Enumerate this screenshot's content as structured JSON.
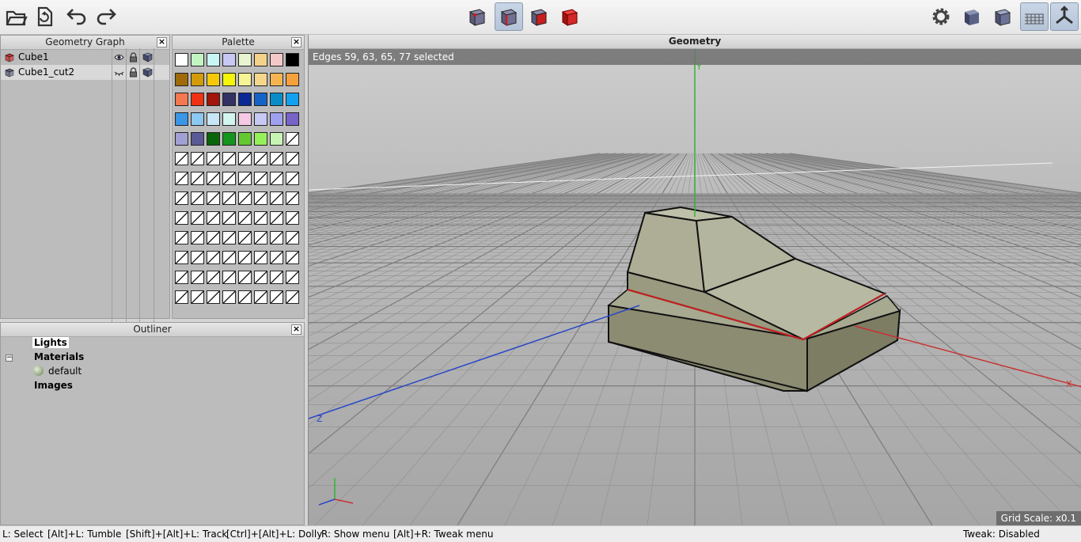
{
  "toolbar": {
    "left_buttons": [
      {
        "name": "open-file-icon"
      },
      {
        "name": "export-file-icon"
      },
      {
        "name": "undo-icon"
      },
      {
        "name": "redo-icon"
      }
    ],
    "mode_buttons": [
      {
        "name": "vertex-mode-icon",
        "active": false
      },
      {
        "name": "edge-mode-icon",
        "active": true
      },
      {
        "name": "face-mode-icon",
        "active": false
      },
      {
        "name": "object-mode-icon",
        "active": false
      }
    ],
    "right_buttons": [
      {
        "name": "settings-gear-icon"
      },
      {
        "name": "smooth-shading-icon"
      },
      {
        "name": "flat-shading-icon"
      },
      {
        "name": "ground-plane-icon",
        "active": true
      },
      {
        "name": "axes-toggle-icon",
        "active": true
      }
    ]
  },
  "geometry_graph": {
    "title": "Geometry Graph",
    "items": [
      {
        "label": "Cube1",
        "color": "#d42a2a",
        "visible": true,
        "selected": false
      },
      {
        "label": "Cube1_cut2",
        "color": "#5a6080",
        "visible": false,
        "selected": true
      }
    ]
  },
  "palette": {
    "title": "Palette",
    "colors": [
      "#ffffff",
      "#c2f5c2",
      "#c8f5f5",
      "#c8c8f5",
      "#e8f5d0",
      "#f5d28a",
      "#f5c8c8",
      "#000000",
      "#a0690a",
      "#d29b0a",
      "#f5c80a",
      "#f5f50a",
      "#f5f596",
      "#f5d78c",
      "#f5b450",
      "#f5a03c",
      "#f57850",
      "#f03214",
      "#a0140a",
      "#323264",
      "#0a2896",
      "#1464c8",
      "#0a8cc8",
      "#14a0f0",
      "#3c96e6",
      "#8cc8f0",
      "#c8e6f5",
      "#d2f5f0",
      "#f5c8e6",
      "#c8c8f5",
      "#a0a0f0",
      "#7864c8",
      "#a0a0d2",
      "#5a5a96",
      "#0a640a",
      "#14961e",
      "#64c832",
      "#96f05a",
      "#c8f5b4",
      "empty"
    ],
    "empty_rows": 8,
    "cols": 8
  },
  "outliner": {
    "title": "Outliner",
    "lights": "Lights",
    "materials": "Materials",
    "toggle": "−",
    "material_items": [
      {
        "label": "default",
        "color": "#9ab08a"
      }
    ],
    "images": "Images"
  },
  "viewport": {
    "title": "Geometry",
    "status": "Edges 59, 63, 65, 77 selected",
    "axis_labels": {
      "x": "X",
      "y": "Y",
      "z": "Z"
    },
    "grid_scale": "Grid Scale: x0.1"
  },
  "statusbar": {
    "hints": [
      "L: Select",
      "[Alt]+L: Tumble",
      "[Shift]+[Alt]+L: Track",
      "[Ctrl]+[Alt]+L: Dolly",
      "R: Show menu",
      "[Alt]+R: Tweak menu"
    ],
    "tweak": "Tweak: Disabled"
  },
  "colors": {
    "selection_edge": "#c81e1e",
    "x_axis": "#c83232",
    "y_axis": "#32b432",
    "z_axis": "#2846c8",
    "mesh": "#b8b8a0"
  }
}
